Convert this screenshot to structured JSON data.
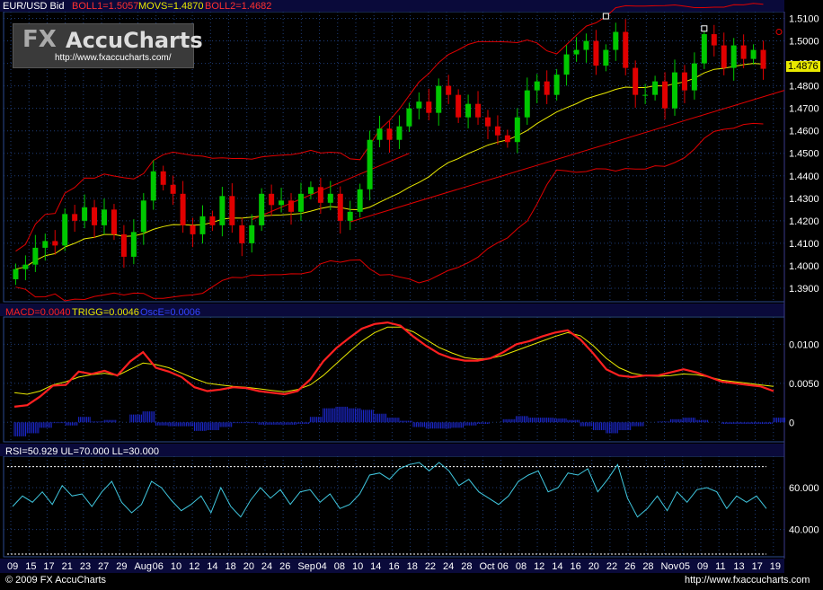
{
  "header": {
    "symbol": "EUR/USD Bid",
    "boll1": "BOLL1=1.5057",
    "movs": "MOVS=1.4870",
    "boll2": "BOLL2=1.4682"
  },
  "logo": {
    "fx": "FX",
    "rest": "AccuCharts",
    "url": "http://www.fxaccucharts.com/"
  },
  "price_tag": "1.4876",
  "macd_header": {
    "macd": "MACD=0.0040",
    "trigg": "TRIGG=0.0046",
    "osce": "OscE=0.0006"
  },
  "rsi_header": {
    "text": "RSI=50.929 UL=70.000 LL=30.000"
  },
  "footer": {
    "left": "© 2009 FX AccuCharts",
    "right": "http://www.fxaccucharts.com"
  },
  "colors": {
    "bull": "#00c800",
    "bear": "#e00000",
    "boll": "#e00000",
    "movs": "#e8e800",
    "grid": "#1e3c78",
    "macd": "#ff2020",
    "trigg": "#e8e800",
    "osc": "#1c28d0",
    "rsi": "#40c8e0"
  },
  "chart_data": [
    {
      "type": "candlestick",
      "title": "EUR/USD Bid",
      "ylim": [
        1.384,
        1.513
      ],
      "yticks": [
        "1.5100",
        "1.5000",
        "1.4900",
        "1.4800",
        "1.4700",
        "1.4600",
        "1.4500",
        "1.4400",
        "1.4300",
        "1.4200",
        "1.4100",
        "1.4000",
        "1.3900"
      ],
      "ytick_values": [
        1.51,
        1.5,
        1.49,
        1.48,
        1.47,
        1.46,
        1.45,
        1.44,
        1.43,
        1.42,
        1.41,
        1.4,
        1.39
      ],
      "xticks": [
        "09",
        "15",
        "17",
        "21",
        "23",
        "27",
        "29",
        "Aug",
        "06",
        "10",
        "12",
        "14",
        "18",
        "20",
        "24",
        "26",
        "Sep",
        "04",
        "08",
        "10",
        "14",
        "16",
        "18",
        "22",
        "24",
        "28",
        "Oct",
        "06",
        "08",
        "12",
        "14",
        "16",
        "20",
        "22",
        "26",
        "28",
        "Nov",
        "05",
        "09",
        "11",
        "13",
        "17",
        "19"
      ],
      "close": [
        1.3985,
        1.4005,
        1.408,
        1.411,
        1.409,
        1.423,
        1.42,
        1.426,
        1.418,
        1.425,
        1.414,
        1.404,
        1.415,
        1.429,
        1.442,
        1.436,
        1.432,
        1.418,
        1.414,
        1.422,
        1.418,
        1.431,
        1.418,
        1.41,
        1.418,
        1.432,
        1.427,
        1.429,
        1.424,
        1.432,
        1.435,
        1.428,
        1.432,
        1.42,
        1.424,
        1.434,
        1.456,
        1.461,
        1.456,
        1.462,
        1.47,
        1.473,
        1.468,
        1.48,
        1.476,
        1.466,
        1.472,
        1.466,
        1.462,
        1.458,
        1.455,
        1.466,
        1.478,
        1.482,
        1.476,
        1.485,
        1.494,
        1.496,
        1.5,
        1.489,
        1.496,
        1.504,
        1.488,
        1.476,
        1.476,
        1.482,
        1.47,
        1.486,
        1.478,
        1.49,
        1.503,
        1.498,
        1.488,
        1.498,
        1.492,
        1.496,
        1.4876
      ],
      "series": [
        {
          "name": "BOLL1",
          "last": 1.5057
        },
        {
          "name": "MOVS",
          "last": 1.487
        },
        {
          "name": "BOLL2",
          "last": 1.4682
        }
      ]
    },
    {
      "type": "line",
      "title": "MACD",
      "ylim": [
        -0.0025,
        0.0135
      ],
      "yticks": [
        "0.0100",
        "0.0050",
        "0"
      ],
      "ytick_values": [
        0.01,
        0.005,
        0
      ],
      "series": [
        {
          "name": "MACD",
          "values": [
            0.002,
            0.0022,
            0.0033,
            0.0047,
            0.0048,
            0.0065,
            0.0062,
            0.0066,
            0.006,
            0.0078,
            0.009,
            0.007,
            0.0065,
            0.0058,
            0.0045,
            0.004,
            0.0042,
            0.0045,
            0.0044,
            0.004,
            0.0038,
            0.0036,
            0.004,
            0.0055,
            0.0078,
            0.0095,
            0.0108,
            0.012,
            0.0126,
            0.0128,
            0.0124,
            0.011,
            0.0098,
            0.0088,
            0.0082,
            0.0079,
            0.0079,
            0.0082,
            0.009,
            0.01,
            0.0104,
            0.011,
            0.0115,
            0.0118,
            0.0106,
            0.0088,
            0.0068,
            0.006,
            0.0058,
            0.006,
            0.006,
            0.0064,
            0.0068,
            0.0064,
            0.0058,
            0.0052,
            0.005,
            0.0048,
            0.0046,
            0.004
          ]
        },
        {
          "name": "TRIGG",
          "values": [
            0.0038,
            0.0036,
            0.004,
            0.0048,
            0.0052,
            0.0058,
            0.0061,
            0.0063,
            0.006,
            0.0068,
            0.0076,
            0.0074,
            0.007,
            0.0063,
            0.0056,
            0.005,
            0.0048,
            0.0046,
            0.0045,
            0.0043,
            0.0041,
            0.0039,
            0.0042,
            0.0048,
            0.006,
            0.0075,
            0.009,
            0.0104,
            0.0115,
            0.0122,
            0.0122,
            0.0116,
            0.0106,
            0.0096,
            0.0089,
            0.0083,
            0.0081,
            0.0082,
            0.0086,
            0.0092,
            0.0098,
            0.0104,
            0.011,
            0.0115,
            0.0111,
            0.0098,
            0.0082,
            0.007,
            0.0063,
            0.006,
            0.0059,
            0.006,
            0.0062,
            0.0061,
            0.0058,
            0.0054,
            0.0052,
            0.005,
            0.0048,
            0.0046
          ]
        },
        {
          "name": "OscE",
          "values": [
            -0.0018,
            -0.0014,
            -0.0007,
            -0.0001,
            -0.0004,
            0.0007,
            0.0001,
            0.0003,
            0,
            0.001,
            0.0014,
            -0.0004,
            -0.0005,
            -0.0005,
            -0.0011,
            -0.001,
            -0.0006,
            -0.0001,
            -0.0001,
            -0.0003,
            -0.0003,
            -0.0003,
            -0.0002,
            0.0007,
            0.0018,
            0.002,
            0.0018,
            0.0016,
            0.0011,
            0.0006,
            0.0002,
            -0.0006,
            -0.0008,
            -0.0008,
            -0.0007,
            -0.0004,
            -0.0002,
            0,
            0.0004,
            0.0008,
            0.0006,
            0.0006,
            0.0005,
            0.0003,
            -0.0005,
            -0.001,
            -0.0014,
            -0.001,
            -0.0005,
            0,
            0.0001,
            0.0004,
            0.0006,
            0.0003,
            0,
            -0.0002,
            -0.0002,
            -0.0002,
            -0.0002,
            0.0006
          ]
        }
      ]
    },
    {
      "type": "line",
      "title": "RSI",
      "ylim": [
        27,
        75
      ],
      "yticks": [
        "60.000",
        "40.000"
      ],
      "ytick_values": [
        60,
        40
      ],
      "levels": {
        "UL": 70,
        "LL": 30
      },
      "series": [
        {
          "name": "RSI",
          "values": [
            51,
            56,
            53,
            58,
            52,
            61,
            56,
            57,
            51,
            58,
            63,
            53,
            48,
            52,
            63,
            60,
            54,
            49,
            52,
            56,
            48,
            60,
            51,
            46,
            54,
            60,
            55,
            59,
            52,
            58,
            59,
            53,
            57,
            50,
            52,
            57,
            66,
            67,
            64,
            69,
            71,
            72,
            68,
            72,
            68,
            61,
            64,
            58,
            55,
            52,
            56,
            63,
            66,
            68,
            58,
            60,
            67,
            66,
            69,
            58,
            64,
            71,
            55,
            46,
            50,
            56,
            49,
            58,
            53,
            59,
            60,
            58,
            50,
            56,
            53,
            56,
            50
          ]
        }
      ]
    }
  ]
}
